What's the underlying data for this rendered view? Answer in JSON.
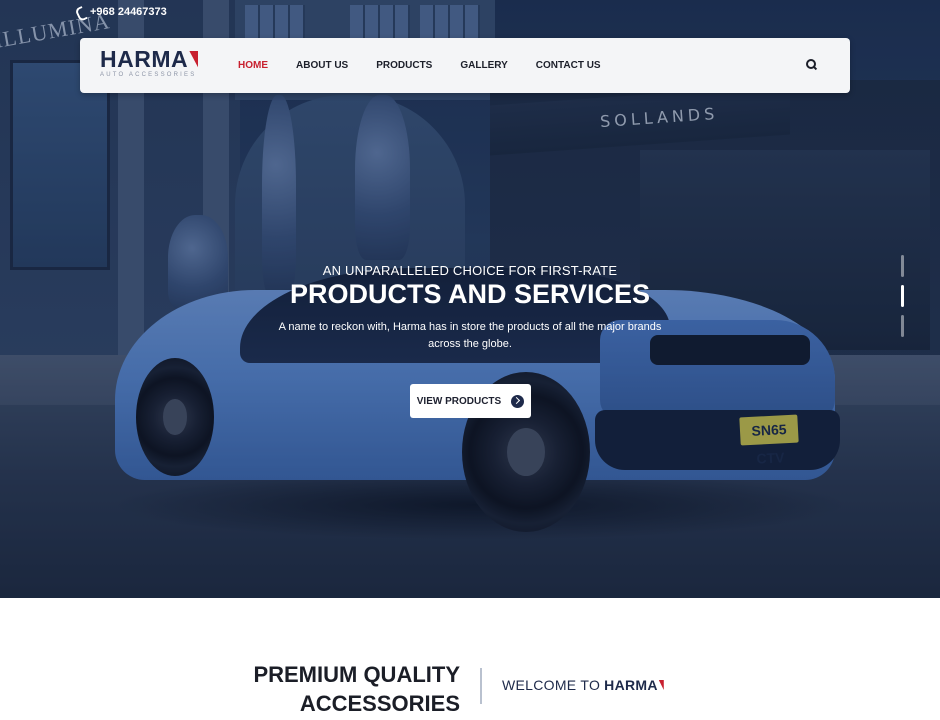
{
  "topbar": {
    "phone": "+968 24467373",
    "phone_icon": "phone-icon"
  },
  "brand": {
    "name": "HARMA",
    "tagline": "AUTO ACCESSORIES",
    "accent_color": "#c8202f",
    "primary_color": "#1e2a4a"
  },
  "nav": {
    "items": [
      {
        "label": "HOME",
        "active": true
      },
      {
        "label": "ABOUT US",
        "active": false
      },
      {
        "label": "PRODUCTS",
        "active": false
      },
      {
        "label": "GALLERY",
        "active": false
      },
      {
        "label": "CONTACT US",
        "active": false
      }
    ],
    "search_icon": "search-icon"
  },
  "hero": {
    "kicker": "AN UNPARALLELED CHOICE FOR FIRST-RATE",
    "title": "PRODUCTS AND SERVICES",
    "subtitle": "A name to reckon with, Harma has in store the products of all the major brands across the globe.",
    "cta_label": "VIEW PRODUCTS",
    "cta_icon": "chevron-right-circle-icon",
    "background_signs": {
      "shop_sign": "SOLLANDS",
      "building_sign": "ILLUMINA",
      "plate": "SN65 CTV"
    },
    "slides": {
      "total": 3,
      "active": 2
    }
  },
  "intro": {
    "heading": "PREMIUM QUALITY\nACCESSORIES",
    "welcome_prefix": "WELCOME TO",
    "welcome_brand": "HARMA"
  }
}
